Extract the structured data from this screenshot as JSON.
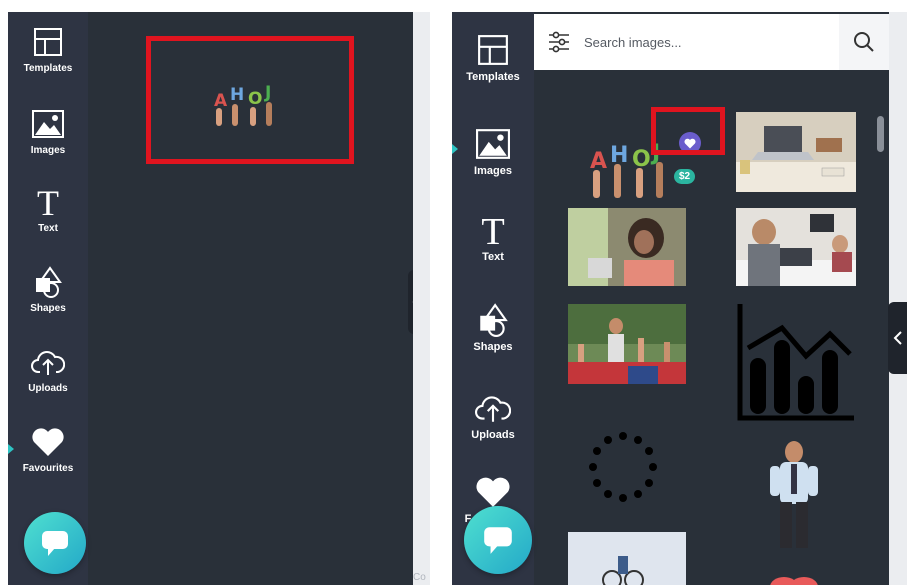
{
  "left_panel": {
    "rail": [
      {
        "label": "Templates",
        "icon": "templates-icon"
      },
      {
        "label": "Images",
        "icon": "image-icon"
      },
      {
        "label": "Text",
        "icon": "text-icon"
      },
      {
        "label": "Shapes",
        "icon": "shapes-icon"
      },
      {
        "label": "Uploads",
        "icon": "upload-icon"
      },
      {
        "label": "Favourites",
        "icon": "heart-icon"
      }
    ],
    "active_item": "Favourites",
    "favourite_item_text": "AHOJ",
    "canvas_edge_text": "Co"
  },
  "right_panel": {
    "search": {
      "placeholder": "Search images..."
    },
    "rail": [
      {
        "label": "Templates",
        "icon": "templates-icon"
      },
      {
        "label": "Images",
        "icon": "image-icon"
      },
      {
        "label": "Text",
        "icon": "text-icon"
      },
      {
        "label": "Shapes",
        "icon": "shapes-icon"
      },
      {
        "label": "Uploads",
        "icon": "upload-icon"
      },
      {
        "label": "F",
        "icon": "heart-icon"
      }
    ],
    "active_item": "Images",
    "ahoj_text": "AHOJ",
    "price_badge": "$2"
  },
  "colors": {
    "rail_bg": "#2e3443",
    "panel_bg": "#293039",
    "accent_teal": "#2ec4c4",
    "highlight_red": "#e0141f",
    "favourite_purple": "#6a5dcc",
    "price_green": "#2bb5a0"
  }
}
